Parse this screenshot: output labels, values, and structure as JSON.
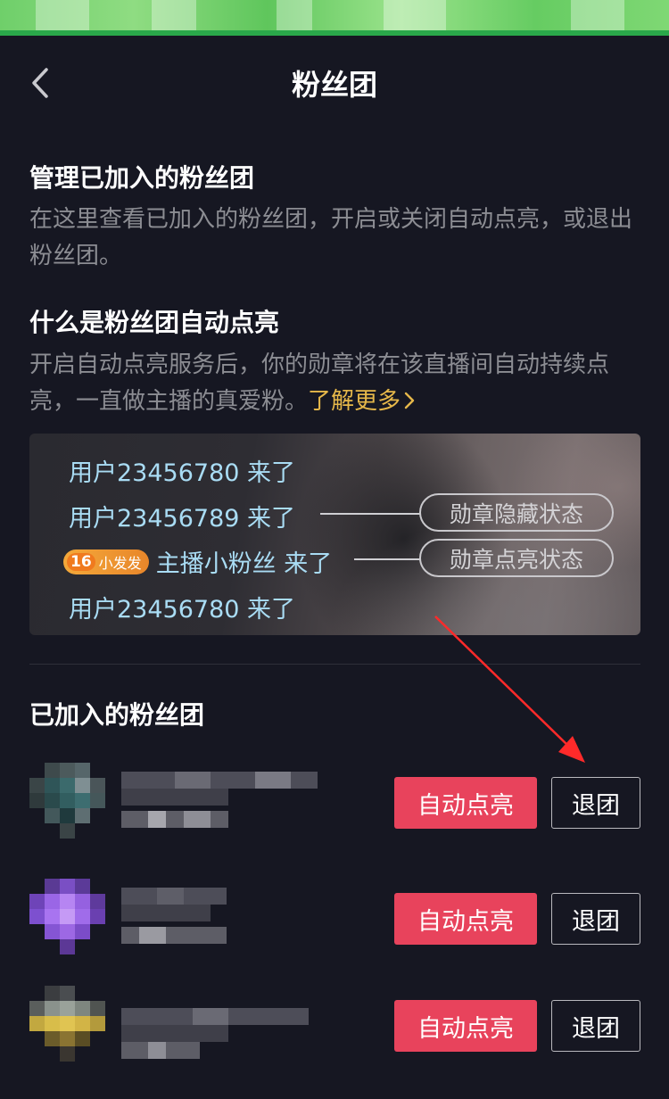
{
  "nav": {
    "title": "粉丝团"
  },
  "manage": {
    "heading": "管理已加入的粉丝团",
    "desc": "在这里查看已加入的粉丝团，开启或关闭自动点亮，或退出粉丝团。"
  },
  "what": {
    "heading": "什么是粉丝团自动点亮",
    "desc": "开启自动点亮服务后，你的勋章将在该直播间自动持续点亮，一直做主播的真爱粉。",
    "learn_more": "了解更多"
  },
  "banner": {
    "line1": "用户23456780 来了",
    "line2": "用户23456789 来了",
    "line3_badge_level": "16",
    "line3_badge_name": "小发发",
    "line3": "主播小粉丝 来了",
    "line4": "用户23456780 来了",
    "pill_hidden": "勋章隐藏状态",
    "pill_lit": "勋章点亮状态"
  },
  "joined": {
    "heading": "已加入的粉丝团",
    "rows": [
      {
        "auto_label": "自动点亮",
        "quit_label": "退团"
      },
      {
        "auto_label": "自动点亮",
        "quit_label": "退团"
      },
      {
        "auto_label": "自动点亮",
        "quit_label": "退团"
      }
    ]
  },
  "colors": {
    "background": "#161722",
    "accent": "#e8435c",
    "learn_more": "#e6b84a",
    "chat_text": "#a9dcf4",
    "annotation_arrow": "#ff2a2a"
  },
  "icons": [
    "back-arrow-icon",
    "chevron-right-icon"
  ]
}
